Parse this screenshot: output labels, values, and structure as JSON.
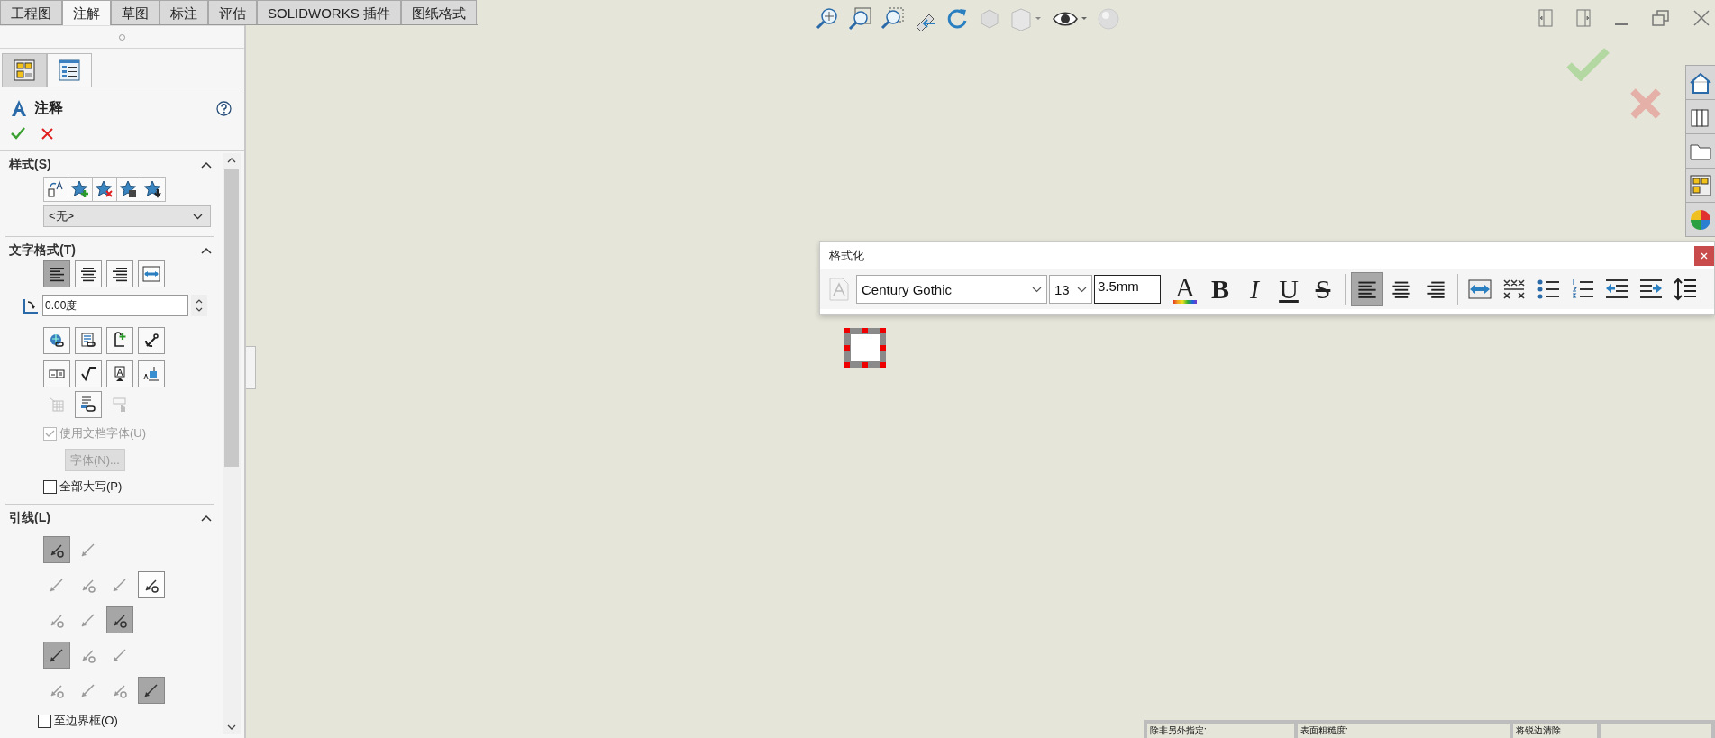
{
  "tabs": [
    {
      "label": "工程图",
      "selected": false
    },
    {
      "label": "注解",
      "selected": true
    },
    {
      "label": "草图",
      "selected": false
    },
    {
      "label": "标注",
      "selected": false
    },
    {
      "label": "评估",
      "selected": false
    },
    {
      "label": "SOLIDWORKS 插件",
      "selected": false
    },
    {
      "label": "图纸格式",
      "selected": false
    }
  ],
  "panel": {
    "title": "注释",
    "style": {
      "title": "样式(S)",
      "value": "<无>"
    },
    "text_format": {
      "title": "文字格式(T)",
      "align": [
        {
          "selected": true
        },
        {
          "selected": false
        },
        {
          "selected": false
        },
        {
          "selected": false
        }
      ],
      "angle": "0.00度",
      "tools": [
        {
          "disabled": false
        },
        {
          "disabled": false
        },
        {
          "disabled": false
        },
        {
          "disabled": false
        },
        {
          "disabled": false
        },
        {
          "disabled": false
        },
        {
          "disabled": false
        },
        {
          "disabled": false
        },
        {
          "disabled": true
        },
        {
          "disabled": false
        },
        {
          "disabled": true
        }
      ],
      "use_doc_font": {
        "label": "使用文档字体(U)",
        "checked": true,
        "disabled": true
      },
      "font_button": {
        "label": "字体(N)...",
        "disabled": true
      },
      "all_caps": {
        "label": "全部大写(P)",
        "checked": false
      }
    },
    "leader": {
      "title": "引线(L)",
      "rows": [
        [
          {
            "selected": true,
            "disabled": false
          },
          {
            "selected": false,
            "disabled": true
          }
        ],
        [
          {
            "selected": false,
            "disabled": true
          },
          {
            "selected": false,
            "disabled": true
          },
          {
            "selected": false,
            "disabled": true
          },
          {
            "selected": false,
            "disabled": false
          }
        ],
        [
          {
            "selected": false,
            "disabled": true
          },
          {
            "selected": false,
            "disabled": true
          },
          {
            "selected": true,
            "disabled": false
          }
        ],
        [
          {
            "selected": true,
            "disabled": false
          },
          {
            "selected": false,
            "disabled": true
          },
          {
            "selected": false,
            "disabled": true
          }
        ],
        [
          {
            "selected": false,
            "disabled": true
          },
          {
            "selected": false,
            "disabled": true
          },
          {
            "selected": false,
            "disabled": true
          },
          {
            "selected": true,
            "disabled": false
          }
        ]
      ],
      "to_border": {
        "label": "至边界框(O)",
        "checked": false
      }
    }
  },
  "format_toolbar": {
    "title": "格式化",
    "font": "Century Gothic",
    "size": "13",
    "height": "3.5mm",
    "styles": [
      {
        "label": "A",
        "kind": "color"
      },
      {
        "label": "B",
        "kind": "bold"
      },
      {
        "label": "I",
        "kind": "italic"
      },
      {
        "label": "U",
        "kind": "underline"
      },
      {
        "label": "S",
        "kind": "strike"
      }
    ],
    "align": [
      {
        "selected": true
      },
      {
        "selected": false
      },
      {
        "selected": false
      }
    ]
  },
  "title_block": {
    "cells": [
      "除非另外指定:",
      "表面粗糙度:",
      "将锐边清除"
    ]
  }
}
